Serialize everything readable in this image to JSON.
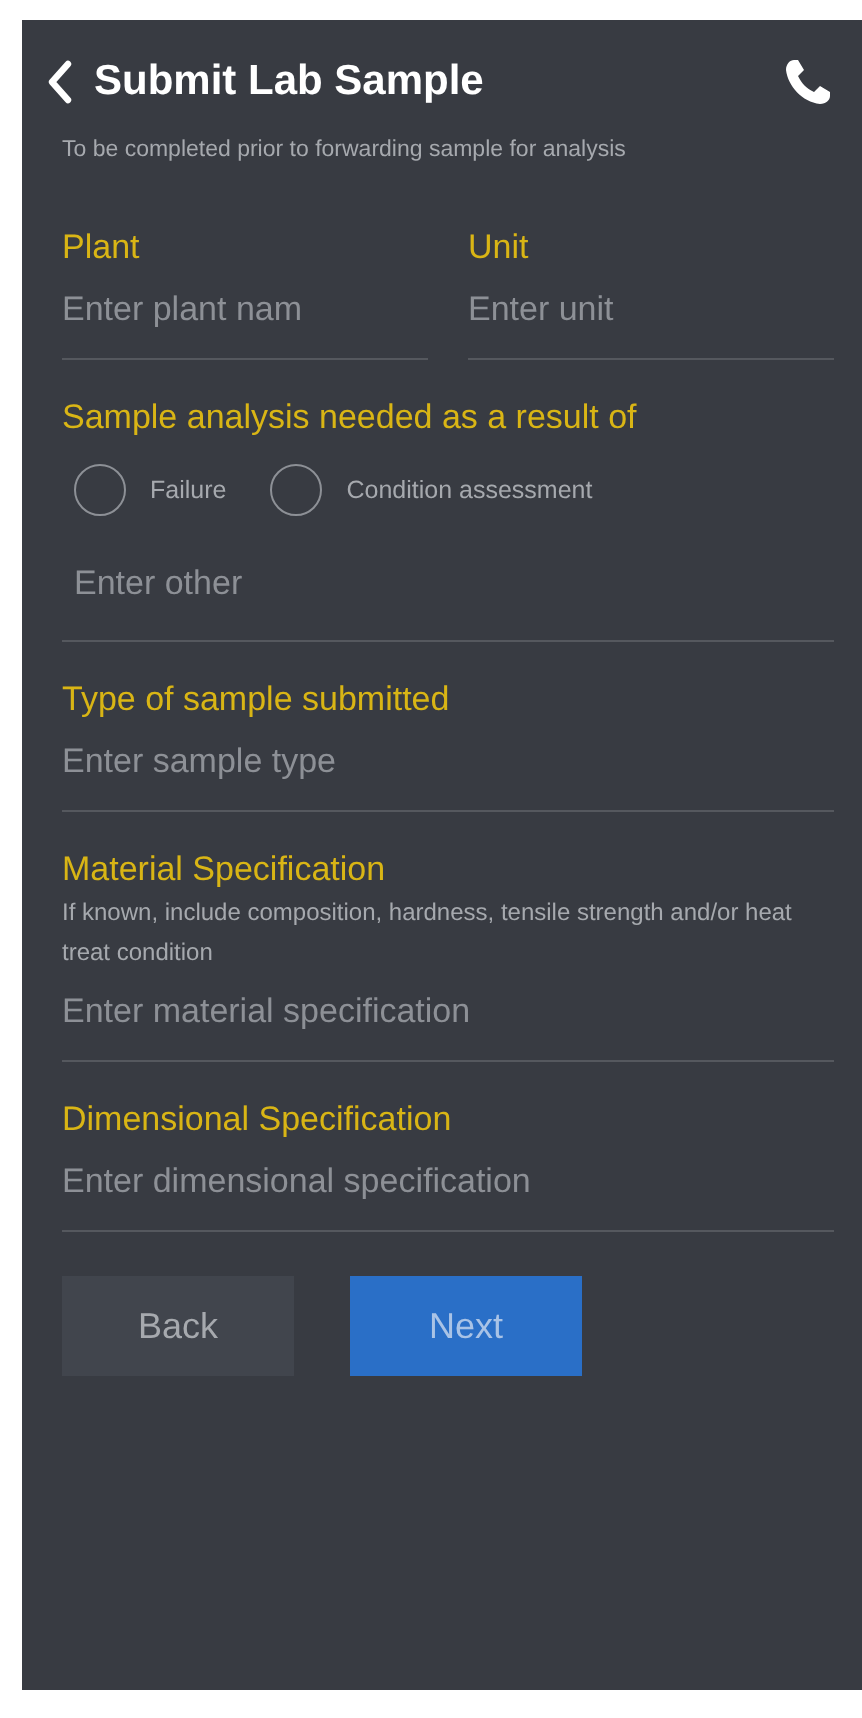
{
  "header": {
    "title": "Submit Lab Sample"
  },
  "intro": "To be completed prior to forwarding sample for analysis",
  "sections": [
    {
      "kind": "pair",
      "fields": [
        {
          "label": "Plant",
          "placeholder": "Enter plant nam"
        },
        {
          "label": "Unit",
          "placeholder": "Enter unit"
        }
      ]
    },
    {
      "kind": "radio",
      "label": "Sample analysis needed as a result of",
      "options": [
        {
          "label": "Failure",
          "selected": false
        },
        {
          "label": "Condition assessment",
          "selected": false
        }
      ],
      "placeholder": "Enter other"
    },
    {
      "kind": "text",
      "label": "Type of sample submitted",
      "placeholder": "Enter sample type"
    },
    {
      "kind": "text",
      "label": "Material Specification",
      "hint": "If known, include composition, hardness, tensile strength and/or heat treat condition",
      "placeholder": "Enter material specification"
    },
    {
      "kind": "text",
      "label": "Dimensional Specification",
      "placeholder": "Enter dimensional specification"
    }
  ],
  "buttons": [
    {
      "label": "Back",
      "kind": "secondary"
    },
    {
      "label": "Next",
      "kind": "primary"
    }
  ]
}
